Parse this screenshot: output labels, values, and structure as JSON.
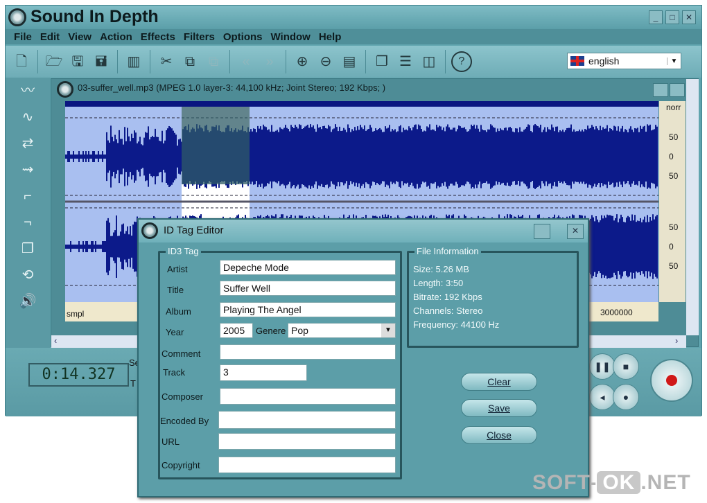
{
  "app": {
    "title": "Sound In Depth",
    "minimize": "_",
    "maximize": "□",
    "close": "✕"
  },
  "menu": [
    "File",
    "Edit",
    "View",
    "Action",
    "Effects",
    "Filters",
    "Options",
    "Window",
    "Help"
  ],
  "toolbar": {
    "icons": [
      "new-file",
      "open",
      "save",
      "save-as",
      "spectrum",
      "cut",
      "copy",
      "paste",
      "undo",
      "redo",
      "zoom-in",
      "zoom-out",
      "fit-window",
      "cascade",
      "tile-horizontal",
      "tile-vertical",
      "help"
    ],
    "language": "english"
  },
  "left_tools": [
    "waveform",
    "amplify",
    "reverse",
    "echo",
    "fade-in",
    "fade-out",
    "windows",
    "loop",
    "volume"
  ],
  "document": {
    "title": "03-suffer_well.mp3 (MPEG 1.0 layer-3: 44,100 kHz; Joint Stereo; 192 Kbps; )",
    "ruler": [
      "norr",
      "50",
      "0",
      "50",
      "50",
      "0",
      "50"
    ],
    "timeline_unit": "smpl",
    "timeline_label": "3000000",
    "selection_color": "#2e5b66"
  },
  "transport": {
    "time": "0:14.327",
    "label_s": "Se",
    "label_t": "T"
  },
  "dialog": {
    "title": "ID Tag Editor",
    "id3_group": "ID3 Tag",
    "fields": {
      "artist_label": "Artist",
      "artist": "Depeche Mode",
      "title_label": "Title",
      "title": "Suffer Well",
      "album_label": "Album",
      "album": "Playing The Angel",
      "year_label": "Year",
      "year": "2005",
      "genre_label": "Genere",
      "genre": "Pop",
      "comment_label": "Comment",
      "comment": "",
      "track_label": "Track",
      "track": "3",
      "composer_label": "Composer",
      "composer": "",
      "encoded_label": "Encoded By",
      "encoded": "",
      "url_label": "URL",
      "url": "",
      "copyright_label": "Copyright",
      "copyright": ""
    },
    "file_info_group": "File Information",
    "file_info": [
      "Size: 5.26 MB",
      "Length: 3:50",
      "Bitrate: 192 Kbps",
      "Channels: Stereo",
      "Frequency: 44100 Hz"
    ],
    "buttons": {
      "clear": "Clear",
      "save": "Save",
      "close": "Close"
    }
  },
  "watermark": {
    "a": "SOFT-",
    "b": "OK",
    "c": ".NET"
  }
}
